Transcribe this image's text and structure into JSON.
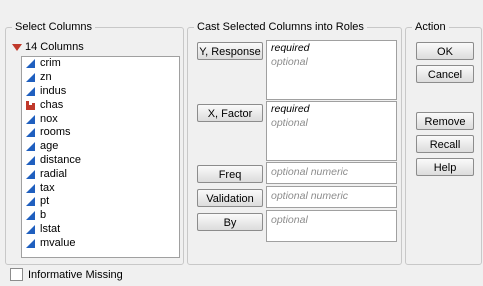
{
  "select_columns": {
    "title": "Select Columns",
    "count_label": "14 Columns",
    "columns": [
      {
        "name": "crim",
        "type": "continuous"
      },
      {
        "name": "zn",
        "type": "continuous"
      },
      {
        "name": "indus",
        "type": "continuous"
      },
      {
        "name": "chas",
        "type": "nominal"
      },
      {
        "name": "nox",
        "type": "continuous"
      },
      {
        "name": "rooms",
        "type": "continuous"
      },
      {
        "name": "age",
        "type": "continuous"
      },
      {
        "name": "distance",
        "type": "continuous"
      },
      {
        "name": "radial",
        "type": "continuous"
      },
      {
        "name": "tax",
        "type": "continuous"
      },
      {
        "name": "pt",
        "type": "continuous"
      },
      {
        "name": "b",
        "type": "continuous"
      },
      {
        "name": "lstat",
        "type": "continuous"
      },
      {
        "name": "mvalue",
        "type": "continuous"
      }
    ]
  },
  "cast": {
    "title": "Cast Selected Columns into Roles",
    "roles": [
      {
        "button": "Y, Response",
        "lines": [
          {
            "text": "required",
            "kind": "req"
          },
          {
            "text": "optional",
            "kind": "opt"
          }
        ]
      },
      {
        "button": "X, Factor",
        "lines": [
          {
            "text": "required",
            "kind": "req"
          },
          {
            "text": "optional",
            "kind": "opt"
          }
        ]
      },
      {
        "button": "Freq",
        "lines": [
          {
            "text": "optional numeric",
            "kind": "opt"
          }
        ]
      },
      {
        "button": "Validation",
        "lines": [
          {
            "text": "optional numeric",
            "kind": "opt"
          }
        ]
      },
      {
        "button": "By",
        "lines": [
          {
            "text": "optional",
            "kind": "opt"
          }
        ]
      }
    ]
  },
  "action": {
    "title": "Action",
    "buttons": [
      "OK",
      "Cancel",
      "Remove",
      "Recall",
      "Help"
    ]
  },
  "informative_missing": {
    "label": "Informative Missing",
    "checked": false
  },
  "colors": {
    "continuous_icon": "#1f5fbf",
    "nominal_icon": "#c0392b",
    "optional_text": "#8c8c8c"
  }
}
